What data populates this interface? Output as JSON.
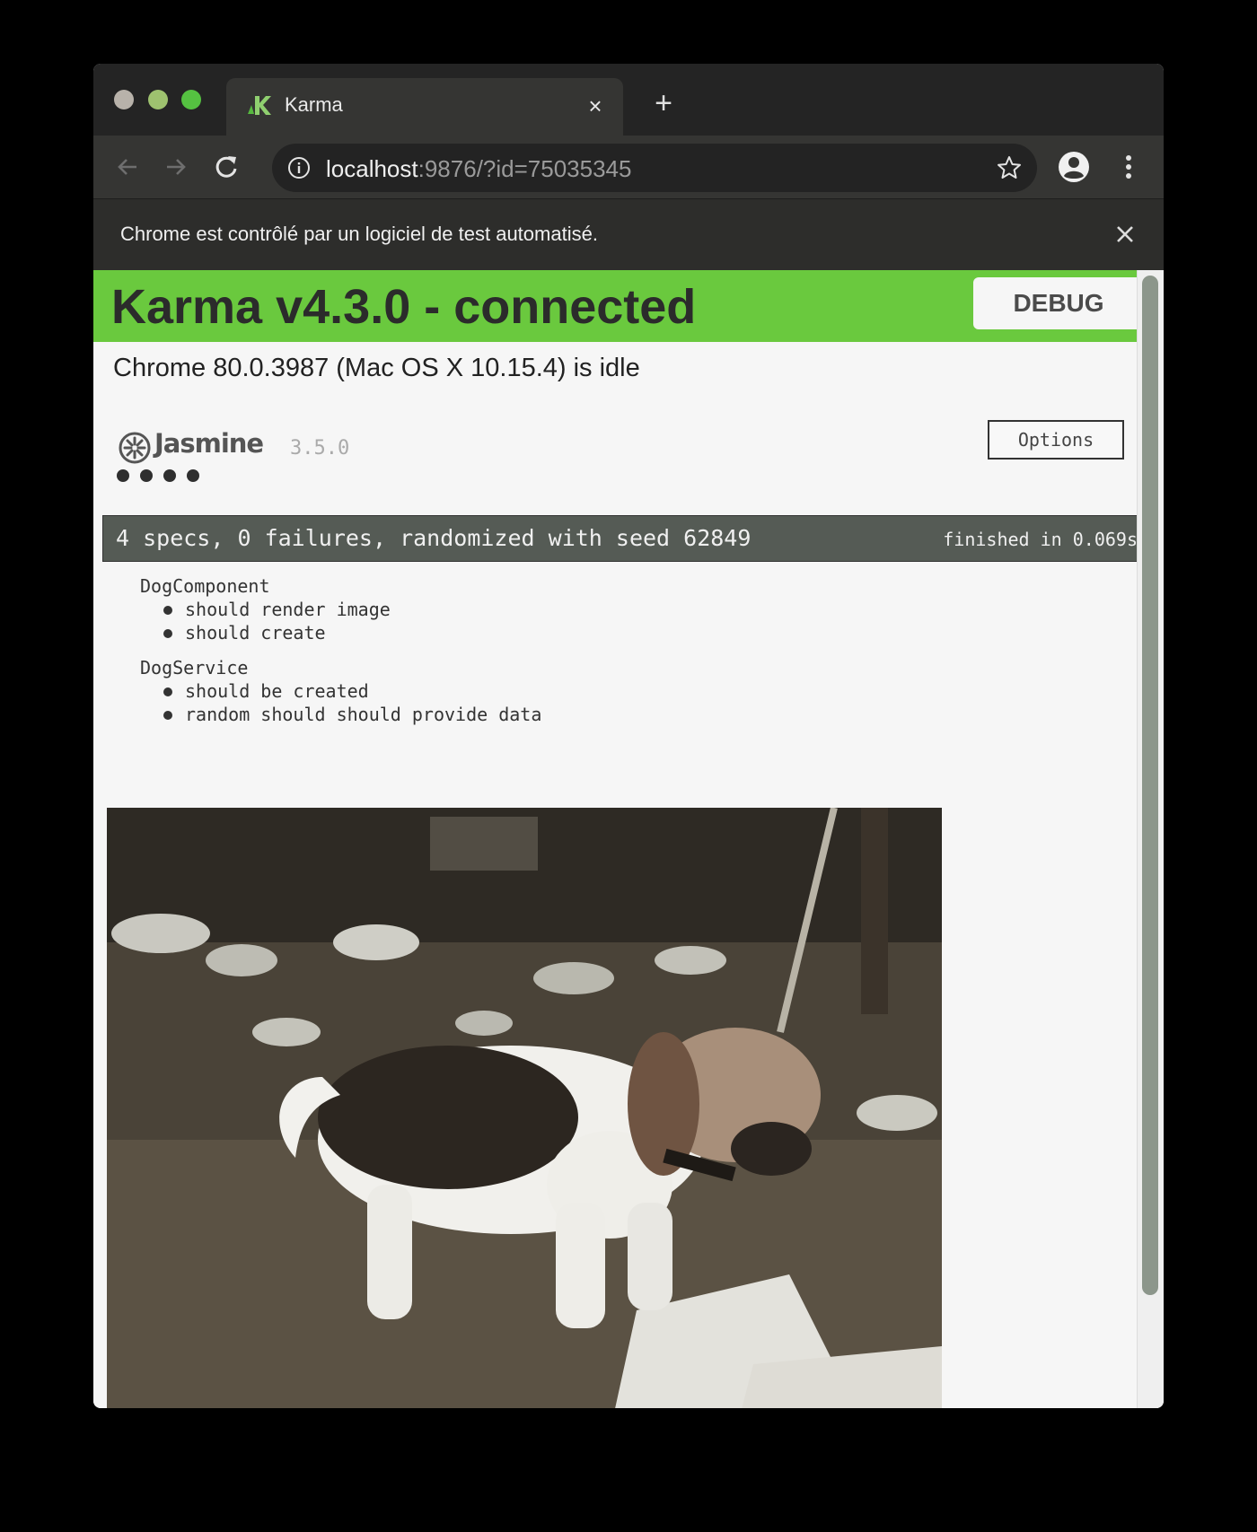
{
  "browser": {
    "tab": {
      "title": "Karma",
      "close_label": "×",
      "new_tab_label": "+"
    },
    "omnibox": {
      "url_host": "localhost",
      "url_rest": ":9876/?id=75035345"
    },
    "infobar": {
      "message": "Chrome est contrôlé par un logiciel de test automatisé."
    },
    "icons": [
      "back-arrow",
      "forward-arrow",
      "reload",
      "info",
      "star",
      "account-circle",
      "more-vert",
      "close"
    ]
  },
  "karma": {
    "banner_title": "Karma v4.3.0 - connected",
    "debug_label": "DEBUG",
    "banner_color": "#6ac93e",
    "browser_status": "Chrome 80.0.3987 (Mac OS X 10.15.4) is idle"
  },
  "jasmine": {
    "logo_text": "Jasmine",
    "version": "3.5.0",
    "options_label": "Options",
    "spec_dot_count": 4,
    "summary": "4 specs, 0 failures, randomized with seed 62849",
    "duration": "finished in 0.069s",
    "suites": [
      {
        "name": "DogComponent",
        "specs": [
          "should render image",
          "should create"
        ]
      },
      {
        "name": "DogService",
        "specs": [
          "should be created",
          "random should should provide data"
        ]
      }
    ]
  }
}
